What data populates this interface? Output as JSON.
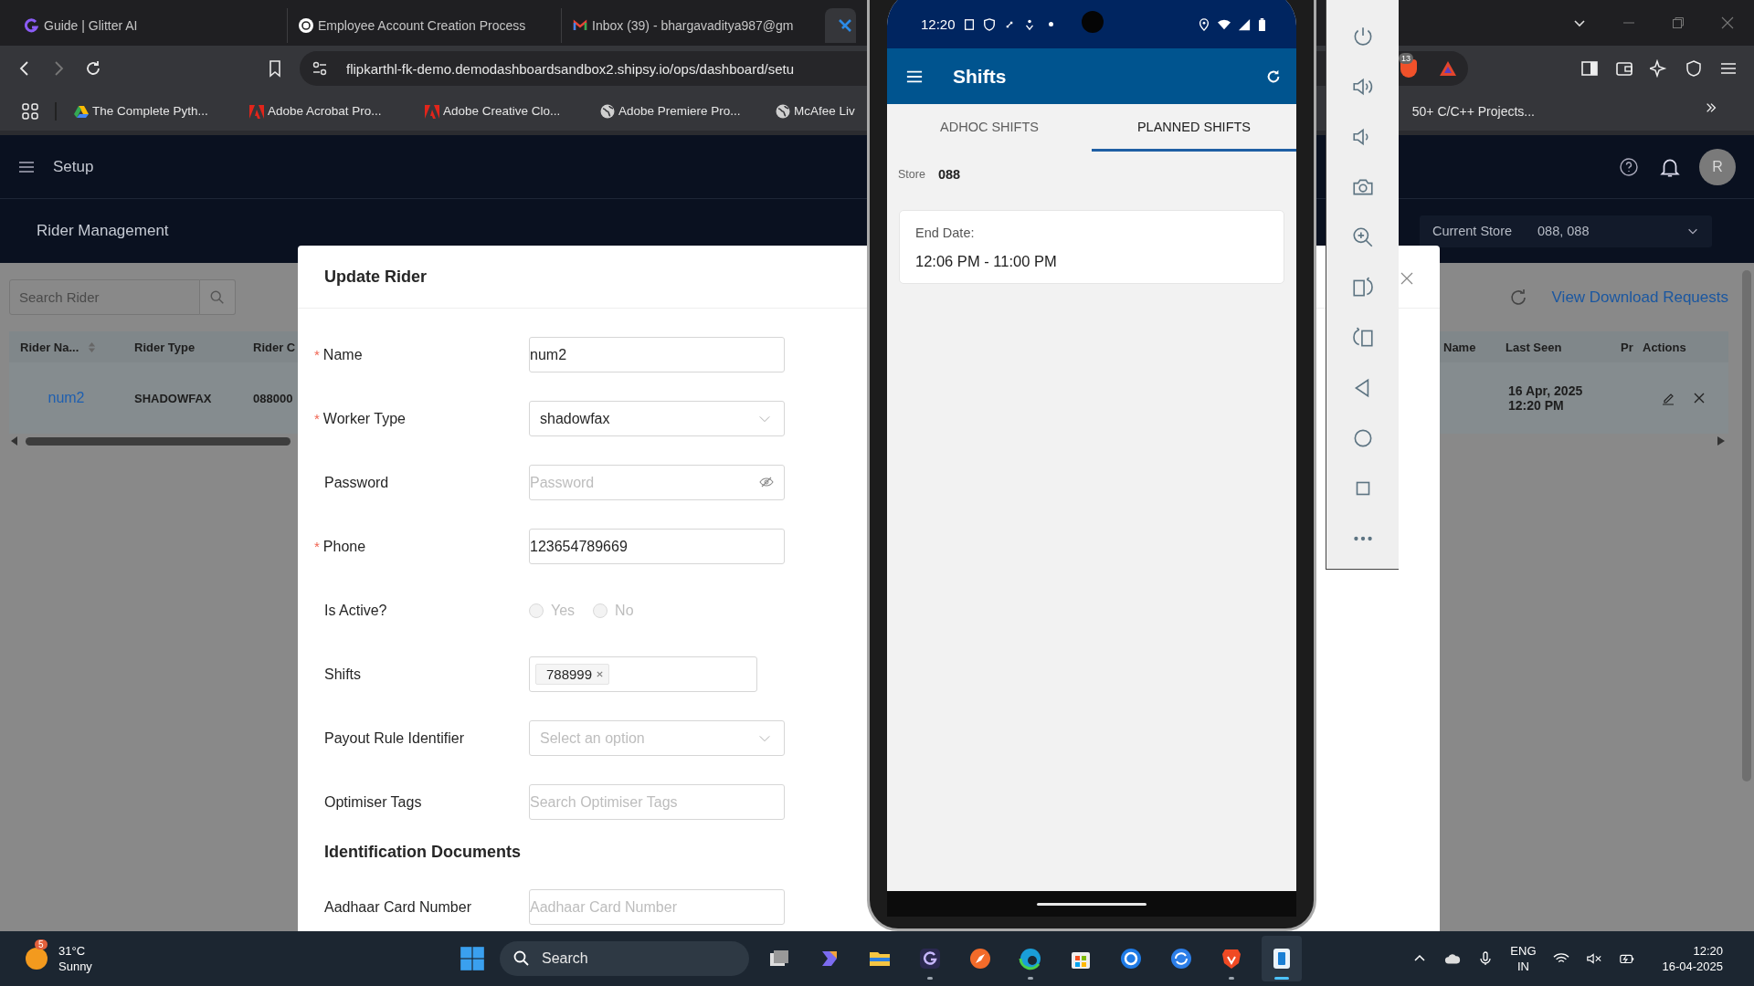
{
  "browser": {
    "tabs": [
      {
        "kind": "glitter",
        "title": "Guide | Glitter AI",
        "selected": false
      },
      {
        "kind": "openai",
        "title": "Employee Account Creation Process",
        "selected": false
      },
      {
        "kind": "gmail",
        "title": "Inbox (39) - bhargavaditya987@gm",
        "selected": false
      },
      {
        "kind": "shipsy",
        "selected": true
      }
    ],
    "url": "flipkarthl-fk-demo.demodashboardsandbox2.shipsy.io/ops/dashboard/setu",
    "extension_badge": "13",
    "bookmarks": [
      {
        "kind": "drive",
        "label": "The Complete Pyth..."
      },
      {
        "kind": "adobe",
        "label": "Adobe Acrobat Pro..."
      },
      {
        "kind": "adobe",
        "label": "Adobe Creative Clo..."
      },
      {
        "kind": "globe",
        "label": "Adobe Premiere Pro..."
      },
      {
        "kind": "globe",
        "label": "McAfee Liv"
      }
    ],
    "bookmark_right": "50+ C/C++ Projects..."
  },
  "app": {
    "title": "Setup",
    "avatar": "R",
    "page": "Rider Management",
    "current_store": {
      "label": "Current Store",
      "value": "088, 088"
    },
    "search": {
      "placeholder": "Search Rider"
    },
    "view_requests": "View Download Requests",
    "table": {
      "columns": [
        "Rider Na...",
        "Rider Type",
        "Rider C",
        "Name",
        "Last Seen",
        "Pr",
        "Actions"
      ],
      "rows": [
        {
          "rider_name": "num2",
          "rider_type": "SHADOWFAX",
          "rider_code": "088000",
          "last_seen": [
            "16 Apr, 2025",
            "12:20 PM"
          ]
        }
      ]
    }
  },
  "modal": {
    "title": "Update Rider",
    "required_mark": "*",
    "fields": [
      {
        "kind": "text",
        "label": "Name",
        "required": true,
        "value": "num2"
      },
      {
        "kind": "select",
        "label": "Worker Type",
        "required": true,
        "value": "shadowfax"
      },
      {
        "kind": "password",
        "label": "Password",
        "required": false,
        "placeholder": "Password"
      },
      {
        "kind": "text",
        "label": "Phone",
        "required": true,
        "value": "123654789669"
      },
      {
        "kind": "radio",
        "label": "Is Active?",
        "required": false,
        "disabled": true,
        "options": [
          {
            "label": "Yes",
            "selected": false
          },
          {
            "label": "No",
            "selected": false
          }
        ]
      },
      {
        "kind": "tags",
        "label": "Shifts",
        "required": false,
        "tags": [
          "788999"
        ]
      },
      {
        "kind": "select",
        "label": "Payout Rule Identifier",
        "required": false,
        "placeholder": "Select an option"
      },
      {
        "kind": "text",
        "label": "Optimiser Tags",
        "required": false,
        "placeholder": "Search Optimiser Tags"
      }
    ],
    "section": "Identification Documents",
    "section_fields": [
      {
        "kind": "text",
        "label": "Aadhaar Card Number",
        "required": false,
        "placeholder": "Aadhaar Card Number"
      }
    ]
  },
  "phone": {
    "time": "12:20",
    "title": "Shifts",
    "tabs": [
      {
        "label": "ADHOC SHIFTS",
        "selected": false
      },
      {
        "label": "PLANNED SHIFTS",
        "selected": true
      }
    ],
    "store_label": "Store",
    "store_value": "088",
    "card": {
      "label": "End Date:",
      "value": "12:06 PM - 11:00 PM"
    }
  },
  "taskbar": {
    "weather": {
      "badge": "5",
      "temp": "31°C",
      "condition": "Sunny"
    },
    "search": "Search",
    "apps": [
      {
        "kind": "taskview",
        "running": false,
        "selected": false
      },
      {
        "kind": "copilot",
        "running": false,
        "selected": false
      },
      {
        "kind": "folder",
        "running": false,
        "selected": false
      },
      {
        "kind": "glitter",
        "running": true,
        "selected": false
      },
      {
        "kind": "compass",
        "running": false,
        "selected": false
      },
      {
        "kind": "edge",
        "running": true,
        "selected": false
      },
      {
        "kind": "store",
        "running": false,
        "selected": false
      },
      {
        "kind": "assist",
        "running": false,
        "selected": false
      },
      {
        "kind": "sync",
        "running": false,
        "selected": false
      },
      {
        "kind": "lion",
        "running": true,
        "selected": false
      },
      {
        "kind": "phone",
        "running": true,
        "selected": true
      }
    ],
    "language": [
      "ENG",
      "IN"
    ],
    "time": "12:20",
    "date": "16-04-2025"
  }
}
